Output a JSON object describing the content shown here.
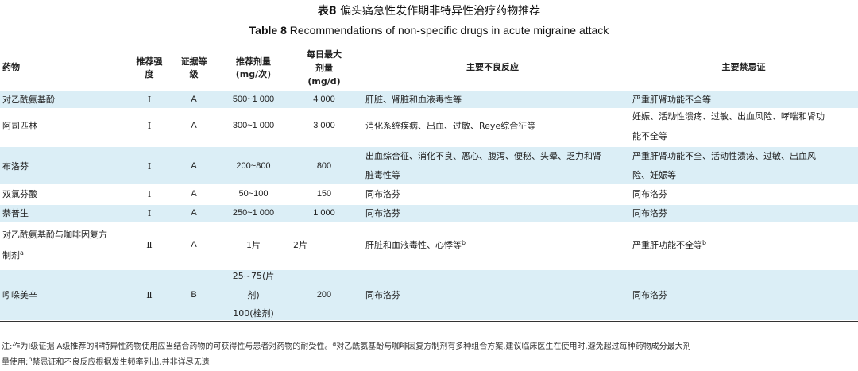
{
  "titles": {
    "cn_label": "表8",
    "cn_text": "偏头痛急性发作期非特异性治疗药物推荐",
    "en_label": "Table 8",
    "en_text": "Recommendations of non-specific drugs in acute migraine attack"
  },
  "headers": {
    "drug": "药物",
    "strength": [
      "推荐强",
      "度"
    ],
    "evidence": [
      "证据等",
      "级"
    ],
    "dose": [
      "推荐剂量",
      "(mg/次)"
    ],
    "maxdose": [
      "每日最大",
      "剂量",
      "(mg/d)"
    ],
    "adverse": "主要不良反应",
    "contra": "主要禁忌证"
  },
  "rows": [
    {
      "drug": "对乙酰氨基酚",
      "strength": "Ⅰ",
      "evidence": "A",
      "dose": "500~1 000",
      "max": "4 000",
      "adverse": "肝脏、肾脏和血液毒性等",
      "contra": "严重肝肾功能不全等"
    },
    {
      "drug": "阿司匹林",
      "strength": "Ⅰ",
      "evidence": "A",
      "dose": "300~1 000",
      "max": "3 000",
      "adverse": "消化系统疾病、出血、过敏、Reye综合征等",
      "contra_1": "妊娠、活动性溃疡、过敏、出血风险、哮喘和肾功",
      "contra_2": "能不全等"
    },
    {
      "drug": "布洛芬",
      "strength": "Ⅰ",
      "evidence": "A",
      "dose": "200~800",
      "max": "800",
      "adverse_1": "出血综合征、消化不良、恶心、腹泻、便秘、头晕、乏力和肾",
      "adverse_2": "脏毒性等",
      "contra_1": "严重肝肾功能不全、活动性溃疡、过敏、出血风",
      "contra_2": "险、妊娠等"
    },
    {
      "drug": "双氯芬酸",
      "strength": "Ⅰ",
      "evidence": "A",
      "dose": "50~100",
      "max": "150",
      "adverse": "同布洛芬",
      "contra": "同布洛芬"
    },
    {
      "drug": "萘普生",
      "strength": "Ⅰ",
      "evidence": "A",
      "dose": "250~1 000",
      "max": "1 000",
      "adverse": "同布洛芬",
      "contra": "同布洛芬"
    },
    {
      "drug_1": "对乙酰氨基酚与咖啡因复方",
      "drug_2": "制剂",
      "drug_sup": "a",
      "strength": "Ⅱ",
      "evidence": "A",
      "dose": "1片",
      "max": "2片",
      "adverse": "肝脏和血液毒性、心悸等",
      "adverse_sup": "b",
      "contra": "严重肝功能不全等",
      "contra_sup": "b"
    },
    {
      "drug": "吲哚美辛",
      "strength": "Ⅱ",
      "evidence": "B",
      "dose_1": "25~75(片",
      "dose_2": "剂)",
      "dose_3": "100(栓剂)",
      "max": "200",
      "adverse": "同布洛芬",
      "contra": "同布洛芬"
    }
  ],
  "footnote": {
    "p1": "注:作为Ⅰ级证据 A级推荐的非特异性药物使用应当结合药物的可获得性与患者对药物的耐受性。",
    "sup_a": "a",
    "p2": "对乙酰氨基酚与咖啡因复方制剂有多种组合方案,建议临床医生在使用时,避免超过每种药物成分最大剂",
    "p3": "量使用;",
    "sup_b": "b",
    "p4": "禁忌证和不良反应根据发生频率列出,并非详尽无遗"
  },
  "colors": {
    "band": "#dbeef6",
    "rule": "#333333"
  }
}
